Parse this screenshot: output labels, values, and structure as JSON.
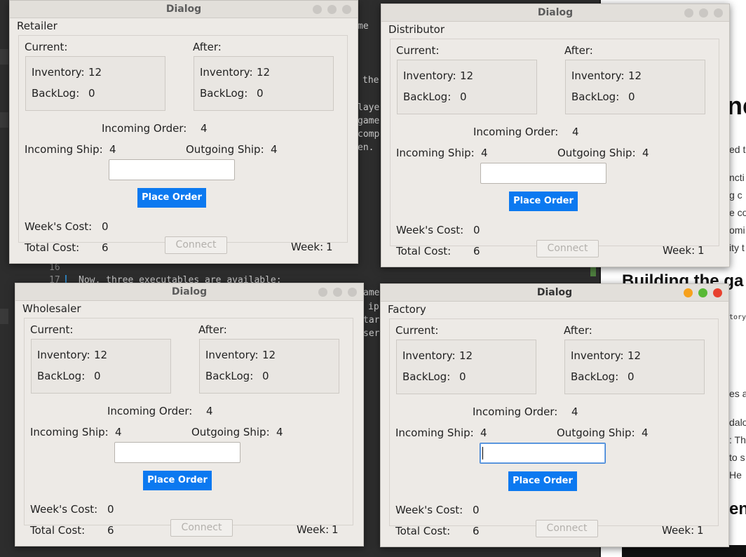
{
  "editor": {
    "right_snippets": [
      "me",
      "the",
      "laye",
      "game",
      "comp",
      "en."
    ],
    "right_snippets_lower": [
      "ame",
      "ip",
      "tar",
      "ser"
    ],
    "line_16": "16",
    "line_17": "17",
    "line_17_text": "Now, three executables are available:",
    "braces": "{{"
  },
  "doc": {
    "big_fragment": "ne",
    "lines_top": [
      "ed t",
      "ncti",
      "g c",
      "e co",
      "omi",
      "ity t"
    ],
    "heading_building": "Building the ga",
    "code_snippet": "tory",
    "lines_bottom": [
      "es a",
      "dalo",
      ": Th",
      "to s",
      "He"
    ],
    "heading_bottom": "ens"
  },
  "dialogs": [
    {
      "title": "Dialog",
      "role": "Retailer",
      "current_label": "Current:",
      "after_label": "After:",
      "inventory_label": "Inventory:",
      "backlog_label": "BackLog:",
      "current_inventory": "12",
      "current_backlog": "0",
      "after_inventory": "12",
      "after_backlog": "0",
      "incoming_order_label": "Incoming Order:",
      "incoming_order": "4",
      "incoming_ship_label": "Incoming Ship:",
      "incoming_ship": "4",
      "outgoing_ship_label": "Outgoing Ship:",
      "outgoing_ship": "4",
      "order_value": "",
      "place_order": "Place Order",
      "weeks_cost_label": "Week's Cost:",
      "weeks_cost": "0",
      "total_cost_label": "Total Cost:",
      "total_cost": "6",
      "connect": "Connect",
      "week_label": "Week:",
      "week": "1"
    },
    {
      "title": "Dialog",
      "role": "Distributor",
      "current_label": "Current:",
      "after_label": "After:",
      "inventory_label": "Inventory:",
      "backlog_label": "BackLog:",
      "current_inventory": "12",
      "current_backlog": "0",
      "after_inventory": "12",
      "after_backlog": "0",
      "incoming_order_label": "Incoming Order:",
      "incoming_order": "4",
      "incoming_ship_label": "Incoming Ship:",
      "incoming_ship": "4",
      "outgoing_ship_label": "Outgoing Ship:",
      "outgoing_ship": "4",
      "order_value": "",
      "place_order": "Place Order",
      "weeks_cost_label": "Week's Cost:",
      "weeks_cost": "0",
      "total_cost_label": "Total Cost:",
      "total_cost": "6",
      "connect": "Connect",
      "week_label": "Week:",
      "week": "1"
    },
    {
      "title": "Dialog",
      "role": "Wholesaler",
      "current_label": "Current:",
      "after_label": "After:",
      "inventory_label": "Inventory:",
      "backlog_label": "BackLog:",
      "current_inventory": "12",
      "current_backlog": "0",
      "after_inventory": "12",
      "after_backlog": "0",
      "incoming_order_label": "Incoming Order:",
      "incoming_order": "4",
      "incoming_ship_label": "Incoming Ship:",
      "incoming_ship": "4",
      "outgoing_ship_label": "Outgoing Ship:",
      "outgoing_ship": "4",
      "order_value": "",
      "place_order": "Place Order",
      "weeks_cost_label": "Week's Cost:",
      "weeks_cost": "0",
      "total_cost_label": "Total Cost:",
      "total_cost": "6",
      "connect": "Connect",
      "week_label": "Week:",
      "week": "1"
    },
    {
      "title": "Dialog",
      "role": "Factory",
      "current_label": "Current:",
      "after_label": "After:",
      "inventory_label": "Inventory:",
      "backlog_label": "BackLog:",
      "current_inventory": "12",
      "current_backlog": "0",
      "after_inventory": "12",
      "after_backlog": "0",
      "incoming_order_label": "Incoming Order:",
      "incoming_order": "4",
      "incoming_ship_label": "Incoming Ship:",
      "incoming_ship": "4",
      "outgoing_ship_label": "Outgoing Ship:",
      "outgoing_ship": "4",
      "order_value": "",
      "place_order": "Place Order",
      "weeks_cost_label": "Week's Cost:",
      "weeks_cost": "0",
      "total_cost_label": "Total Cost:",
      "total_cost": "6",
      "connect": "Connect",
      "week_label": "Week:",
      "week": "1"
    }
  ],
  "colors": {
    "place_order_bg": "#0c79f0",
    "dialog_bg": "#edeae6",
    "close_active": "#e8412f",
    "min_active": "#f6a11c",
    "max_active": "#59b936"
  }
}
